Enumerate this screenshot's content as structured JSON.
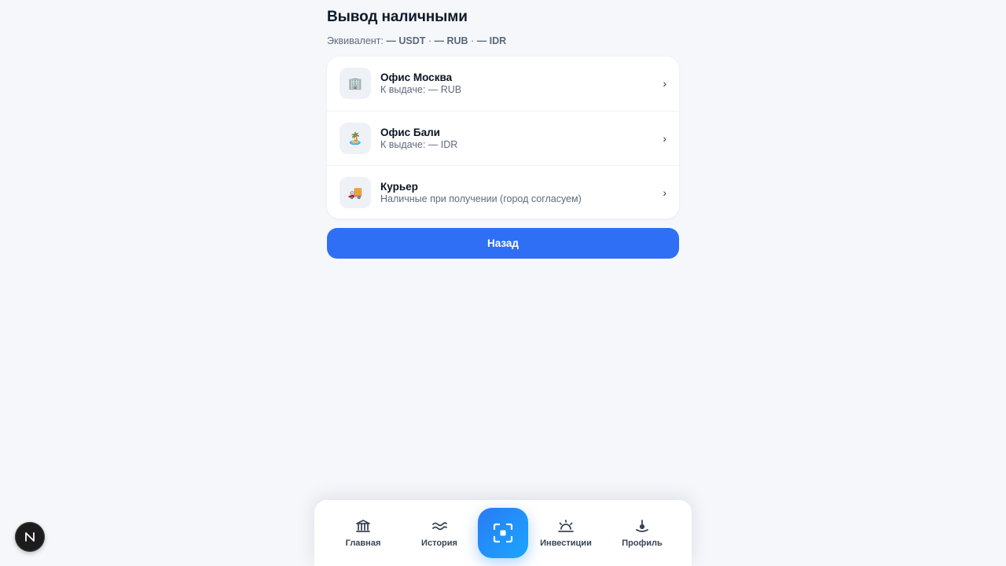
{
  "header": {
    "title": "Вывод наличными",
    "equiv_label": "Эквивалент:",
    "equiv_usdt": "— USDT",
    "equiv_rub": "— RUB",
    "equiv_idr": "— IDR",
    "sep": "·"
  },
  "options": [
    {
      "icon": "🏢",
      "icon_name": "office-building-icon",
      "title": "Офис Москва",
      "subtitle": "К выдаче: — RUB"
    },
    {
      "icon": "🏝️",
      "icon_name": "palm-island-icon",
      "title": "Офис Бали",
      "subtitle": "К выдаче: — IDR"
    },
    {
      "icon": "🚚",
      "icon_name": "delivery-truck-icon",
      "title": "Курьер",
      "subtitle": "Наличные при получении (город согласуем)"
    }
  ],
  "chevron": "›",
  "back_button": {
    "label": "Назад"
  },
  "bottom_nav": {
    "items": [
      {
        "label": "Главная",
        "icon": "bank-icon"
      },
      {
        "label": "История",
        "icon": "waves-icon"
      },
      {
        "label": "Инвестиции",
        "icon": "sunrise-icon"
      },
      {
        "label": "Профиль",
        "icon": "profile-icon"
      }
    ],
    "scan_icon": "scan-icon"
  },
  "dev_badge": {
    "letter": "N"
  },
  "colors": {
    "accent": "#2f6ff6",
    "background": "#f5f7fa",
    "card": "#ffffff"
  }
}
